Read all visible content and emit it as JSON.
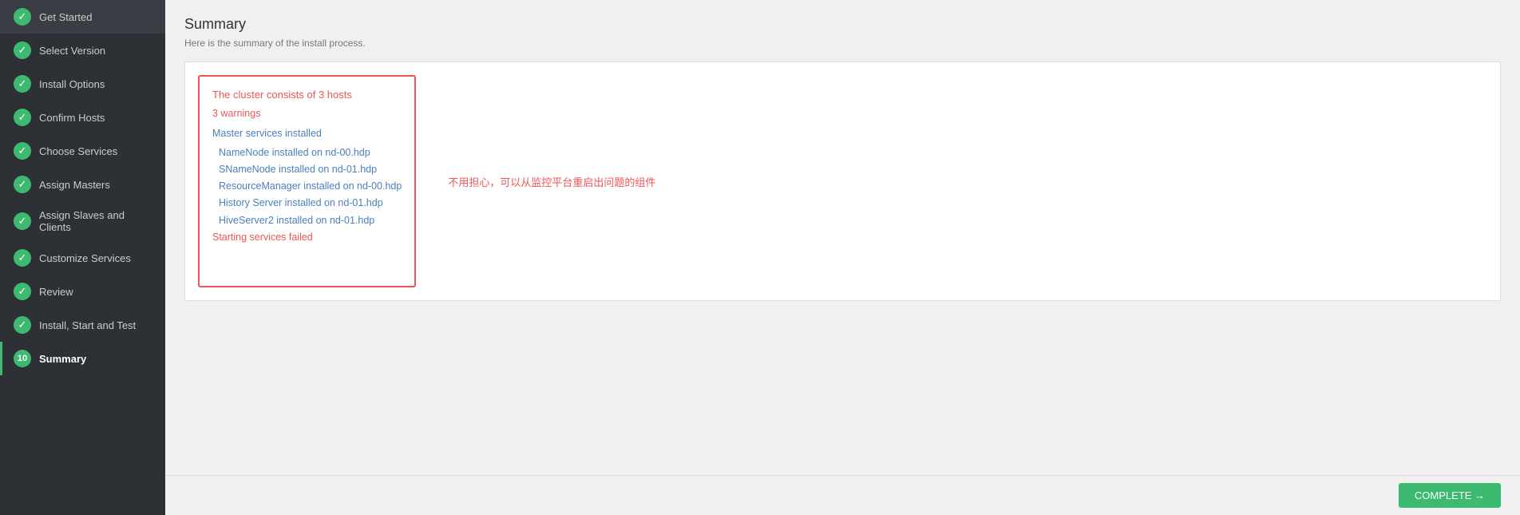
{
  "sidebar": {
    "items": [
      {
        "id": "get-started",
        "label": "Get Started",
        "icon": "check",
        "step": null,
        "active": false
      },
      {
        "id": "select-version",
        "label": "Select Version",
        "icon": "check",
        "step": null,
        "active": false
      },
      {
        "id": "install-options",
        "label": "Install Options",
        "icon": "check",
        "step": null,
        "active": false
      },
      {
        "id": "confirm-hosts",
        "label": "Confirm Hosts",
        "icon": "check",
        "step": null,
        "active": false
      },
      {
        "id": "choose-services",
        "label": "Choose Services",
        "icon": "check",
        "step": null,
        "active": false
      },
      {
        "id": "assign-masters",
        "label": "Assign Masters",
        "icon": "check",
        "step": null,
        "active": false
      },
      {
        "id": "assign-slaves",
        "label": "Assign Slaves and Clients",
        "icon": "check",
        "step": null,
        "active": false
      },
      {
        "id": "customize-services",
        "label": "Customize Services",
        "icon": "check",
        "step": null,
        "active": false
      },
      {
        "id": "review",
        "label": "Review",
        "icon": "check",
        "step": null,
        "active": false
      },
      {
        "id": "install-start-test",
        "label": "Install, Start and Test",
        "icon": "check",
        "step": null,
        "active": false
      },
      {
        "id": "summary",
        "label": "Summary",
        "icon": "number",
        "step": "10",
        "active": true
      }
    ]
  },
  "page": {
    "title": "Summary",
    "subtitle": "Here is the summary of the install process."
  },
  "summary": {
    "cluster_title": "The cluster consists of 3 hosts",
    "warnings": "3 warnings",
    "master_title": "Master services installed",
    "services": [
      "NameNode installed on nd-00.hdp",
      "SNameNode installed on nd-01.hdp",
      "ResourceManager installed on nd-00.hdp",
      "History Server installed on nd-01.hdp",
      "HiveServer2 installed on nd-01.hdp"
    ],
    "failed": "Starting services failed",
    "info_message": "不用担心，可以从监控平台重启出问题的组件"
  },
  "footer": {
    "complete_label": "COMPLETE →"
  }
}
